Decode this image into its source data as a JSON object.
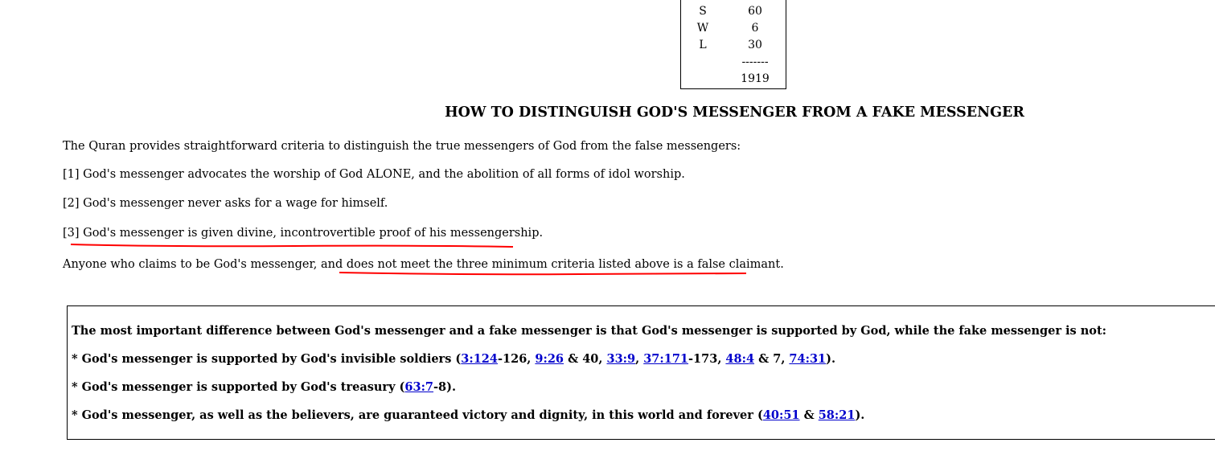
{
  "tally": {
    "rows": [
      {
        "letter": "S",
        "value": "60"
      },
      {
        "letter": "W",
        "value": "6"
      },
      {
        "letter": "L",
        "value": "30"
      }
    ],
    "separator": "-------",
    "total": "1919"
  },
  "heading": "HOW TO DISTINGUISH GOD'S MESSENGER FROM A FAKE MESSENGER",
  "intro": "The Quran provides straightforward criteria to distinguish the true messengers of God from the false messengers:",
  "criteria": [
    {
      "number": "[1]",
      "text": "God's messenger advocates the worship of God ALONE, and the abolition of all forms of idol worship."
    },
    {
      "number": "[2]",
      "text": "God's messenger never asks for a wage for himself."
    },
    {
      "number": "[3]",
      "text": "God's messenger is given divine, incontrovertible proof of his messengership."
    }
  ],
  "conclusion": {
    "lead": "Anyone who claims to be God's messenger, and ",
    "underlined": "does not meet the three minimum criteria listed above is a false claimant",
    "end": "."
  },
  "box": {
    "statement": "The most important difference between God's messenger and a fake messenger is that God's messenger is supported by God, while the fake messenger is not:",
    "soldiers": {
      "text": "* God's messenger is supported by God's invisible soldiers (",
      "r1": "3:124",
      "t1": "-126, ",
      "r2": "9:26",
      "t2": " & 40, ",
      "r3": "33:9",
      "t3": ", ",
      "r4": "37:171",
      "t4": "-173, ",
      "r5": "48:4",
      "t5": " & 7, ",
      "r6": "74:31",
      "t6": ")."
    },
    "treasury": {
      "text": "* God's messenger is supported by God's treasury (",
      "r1": "63:7",
      "t1": "-8)."
    },
    "victory": {
      "text": "* God's messenger, as well as the believers, are guaranteed victory and dignity, in this world and forever (",
      "r1": "40:51",
      "t1": " & ",
      "r2": "58:21",
      "t2": ")."
    }
  },
  "colors": {
    "link": "#0000cc",
    "annotation": "#ff0000"
  }
}
